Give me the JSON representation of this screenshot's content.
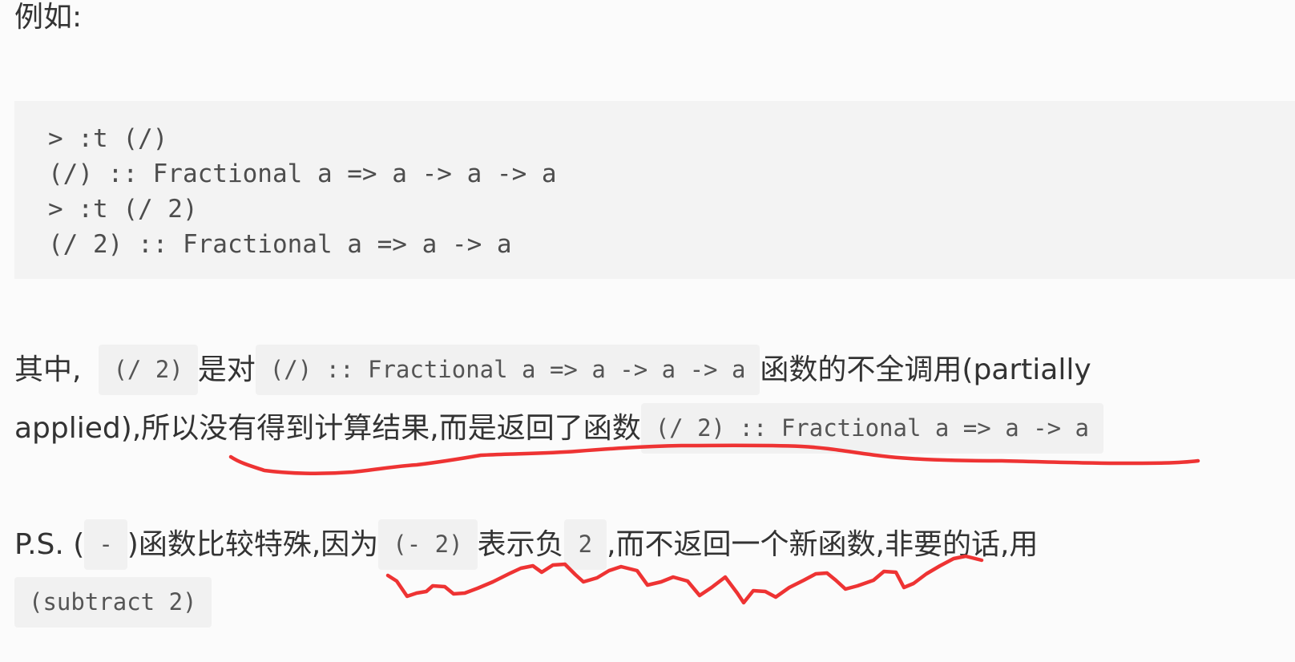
{
  "intro": "例如:",
  "code_block": {
    "lines": [
      "> :t (/)",
      "(/) :: Fractional a => a -> a -> a",
      "> :t (/ 2)",
      "(/ 2) :: Fractional a => a -> a"
    ]
  },
  "paragraph1": {
    "line1": {
      "t1": "其中,",
      "code1": "(/ 2)",
      "t2": "是对",
      "code2": "(/) :: Fractional a => a -> a -> a",
      "t3": "函数的不全调用(partially"
    },
    "line2": {
      "t1": "applied),所以没有得到计算结果,而是返回了函数",
      "code1": "(/ 2) :: Fractional a => a -> a"
    }
  },
  "paragraph2": {
    "line1": {
      "t1": "P.S. (",
      "code1": "-",
      "t2": ")函数比较特殊,因为",
      "code2": "(- 2)",
      "t3": "表示负",
      "code3": "2",
      "t4": ",而不返回一个新函数,非要的话,用"
    },
    "line2": {
      "code1": "(subtract 2)"
    }
  },
  "annotation": {
    "color": "#ee3333"
  }
}
